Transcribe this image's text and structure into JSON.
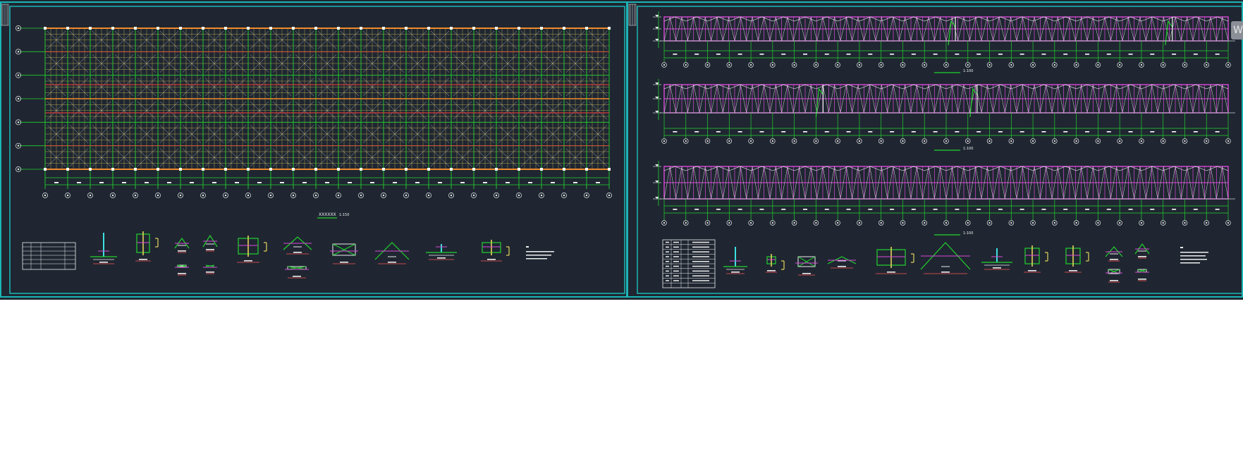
{
  "sheet1": {
    "plan_title": "XXXXXX",
    "plan_scale": "1:150",
    "grid_rows": [
      "A",
      "B",
      "C",
      "D",
      "E",
      "F",
      "G"
    ],
    "grid_cols": [
      "1",
      "2",
      "3",
      "4",
      "5",
      "6",
      "7",
      "8",
      "9",
      "10",
      "11",
      "12",
      "13",
      "14",
      "15",
      "16",
      "17",
      "18",
      "19",
      "20",
      "21",
      "22",
      "23",
      "24",
      "25",
      "26"
    ]
  },
  "sheet2": {
    "elev1_scale": "1:100",
    "elev2_scale": "1:100",
    "elev3_scale": "1:100",
    "grid_cols": [
      "1",
      "2",
      "3",
      "4",
      "5",
      "6",
      "7",
      "8",
      "9",
      "10",
      "11",
      "12",
      "13",
      "14",
      "15",
      "16",
      "17",
      "18",
      "19",
      "20",
      "21",
      "22",
      "23",
      "24",
      "25",
      "26",
      "27"
    ]
  },
  "watermark": "W",
  "colors": {
    "background": "#1f2631",
    "frame": "#1bb5b5",
    "grid_green": "#22d22e",
    "truss_yellow": "#e7d35a",
    "chord_orange": "#f08a2a",
    "red_line": "#ff3a3a",
    "magenta": "#d94ad9",
    "white": "#eeeeee",
    "cyan": "#3de0e0"
  },
  "icons": [
    "detail-drawing-icon",
    "grid-bubble-icon",
    "legend-table-icon"
  ]
}
